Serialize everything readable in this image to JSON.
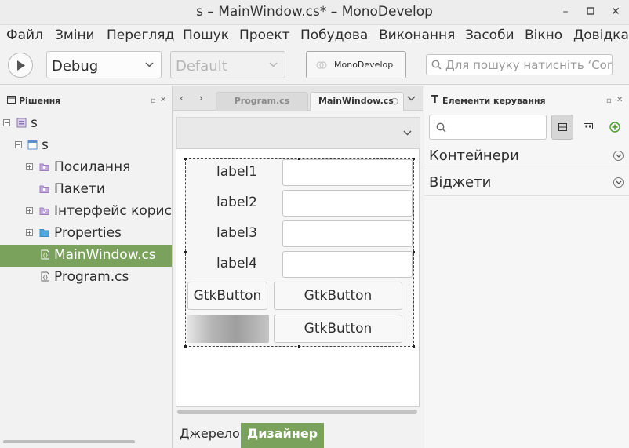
{
  "window": {
    "title": "s – MainWindow.cs* – MonoDevelop"
  },
  "menu": [
    "Файл",
    "Зміни",
    "Перегляд",
    "Пошук",
    "Проект",
    "Побудова",
    "Виконання",
    "Засоби",
    "Вікно",
    "Довідка"
  ],
  "toolbar": {
    "config": "Debug",
    "platform": "Default",
    "status_label": "MonoDevelop",
    "search_placeholder": "Для пошуку натисніть ‘Control+,’"
  },
  "solution": {
    "title": "Рішення",
    "items": [
      {
        "label": "s",
        "kind": "solution",
        "expander": "−"
      },
      {
        "label": "s",
        "kind": "project",
        "expander": "−"
      },
      {
        "label": "Посилання",
        "kind": "folder",
        "expander": "+"
      },
      {
        "label": "Пакети",
        "kind": "folder",
        "expander": ""
      },
      {
        "label": "Інтерфейс користувача",
        "kind": "folder",
        "expander": "+"
      },
      {
        "label": "Properties",
        "kind": "folder",
        "expander": "+"
      },
      {
        "label": "MainWindow.cs",
        "kind": "file",
        "expander": "",
        "selected": true
      },
      {
        "label": "Program.cs",
        "kind": "file",
        "expander": ""
      }
    ]
  },
  "editor": {
    "tabs": [
      {
        "label": "Program.cs",
        "active": false
      },
      {
        "label": "MainWindow.cs",
        "active": true
      }
    ],
    "designer": {
      "labels": [
        "label1",
        "label2",
        "label3",
        "label4"
      ],
      "button_left": "GtkButton",
      "button_right_1": "GtkButton",
      "button_right_2": "GtkButton"
    },
    "bottom_tabs": {
      "source": "Джерело",
      "designer": "Дизайнер"
    }
  },
  "controls": {
    "title": "Елементи керування",
    "sections": [
      "Контейнери",
      "Віджети"
    ]
  },
  "colors": {
    "accent": "#7ba25d",
    "selection_text": "#ffffff"
  }
}
